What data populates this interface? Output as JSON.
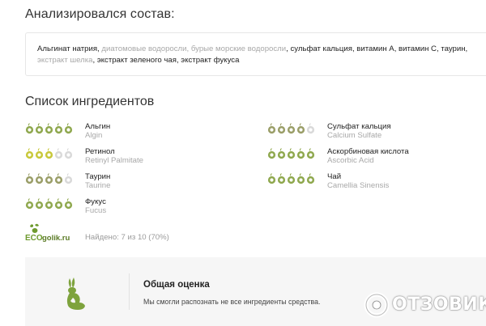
{
  "analyzed": {
    "heading": "Анализировался состав:",
    "parts": [
      {
        "text": "Альгинат натрия",
        "recognized": true
      },
      {
        "text": ", ",
        "recognized": true
      },
      {
        "text": "диатомовые водоросли",
        "recognized": false
      },
      {
        "text": ", ",
        "recognized": false
      },
      {
        "text": "бурые морские водоросли",
        "recognized": false
      },
      {
        "text": ", ",
        "recognized": true
      },
      {
        "text": "сульфат кальция",
        "recognized": true
      },
      {
        "text": ", ",
        "recognized": true
      },
      {
        "text": "витамин А",
        "recognized": true
      },
      {
        "text": ", ",
        "recognized": true
      },
      {
        "text": "витамин С",
        "recognized": true
      },
      {
        "text": ", ",
        "recognized": true
      },
      {
        "text": "таурин",
        "recognized": true
      },
      {
        "text": ", ",
        "recognized": true
      },
      {
        "text": "экстракт шелка",
        "recognized": false
      },
      {
        "text": ", ",
        "recognized": true
      },
      {
        "text": "экстракт зеленого чая",
        "recognized": true
      },
      {
        "text": ", ",
        "recognized": true
      },
      {
        "text": "экстракт фукуса",
        "recognized": true
      }
    ]
  },
  "ingredients": {
    "heading": "Список ингредиентов",
    "items": [
      {
        "name": "Альгин",
        "latin": "Algin",
        "rating": 5,
        "color": "#8fa84e"
      },
      {
        "name": "Ретинол",
        "latin": "Retinyl Palmitate",
        "rating": 3,
        "color": "#c8c83a"
      },
      {
        "name": "Таурин",
        "latin": "Taurine",
        "rating": 4,
        "color": "#9a9e68"
      },
      {
        "name": "Фукус",
        "latin": "Fucus",
        "rating": 5,
        "color": "#8fa84e"
      },
      {
        "name": "Сульфат кальция",
        "latin": "Calcium Sulfate",
        "rating": 4,
        "color": "#9a9e68"
      },
      {
        "name": "Аскорбиновая кислота",
        "latin": "Ascorbic Acid",
        "rating": 5,
        "color": "#8fa84e"
      },
      {
        "name": "Чай",
        "latin": "Camellia Sinensis",
        "rating": 5,
        "color": "#8fa84e"
      }
    ]
  },
  "footer": {
    "logo_text_eco": "ECO",
    "logo_text_golik": "golik.ru",
    "found_text": "Найдено: 7 из 10 (70%)"
  },
  "overall": {
    "title": "Общая оценка",
    "subtitle": "Мы смогли распознать не все ингредиенты средства."
  },
  "watermark": {
    "text": "ОТЗОВИК"
  },
  "colors": {
    "leaf_empty": "#d9d9d9",
    "logo_green": "#6e9a2e",
    "rabbit_green": "#7ea33d"
  }
}
